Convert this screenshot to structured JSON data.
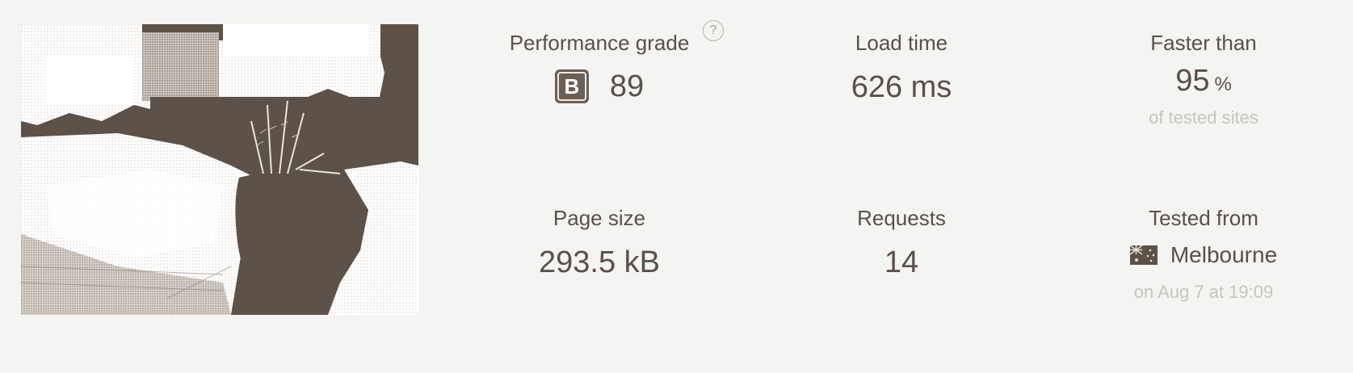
{
  "metrics": {
    "performance": {
      "label": "Performance grade",
      "help": "?",
      "grade": "B",
      "score": "89",
      "badge_color": "#6b5f56"
    },
    "load_time": {
      "label": "Load time",
      "value": "626 ms"
    },
    "faster_than": {
      "label": "Faster than",
      "value": "95",
      "unit": "%",
      "sub": "of tested sites"
    },
    "page_size": {
      "label": "Page size",
      "value": "293.5 kB"
    },
    "requests": {
      "label": "Requests",
      "value": "14"
    },
    "tested_from": {
      "label": "Tested from",
      "flag_icon": "australia-flag-icon",
      "location": "Melbourne",
      "date": "on Aug 7 at 19:09"
    }
  },
  "colors": {
    "text": "#5a5049",
    "muted": "#c8c4bf",
    "background": "#f4f4f2"
  }
}
